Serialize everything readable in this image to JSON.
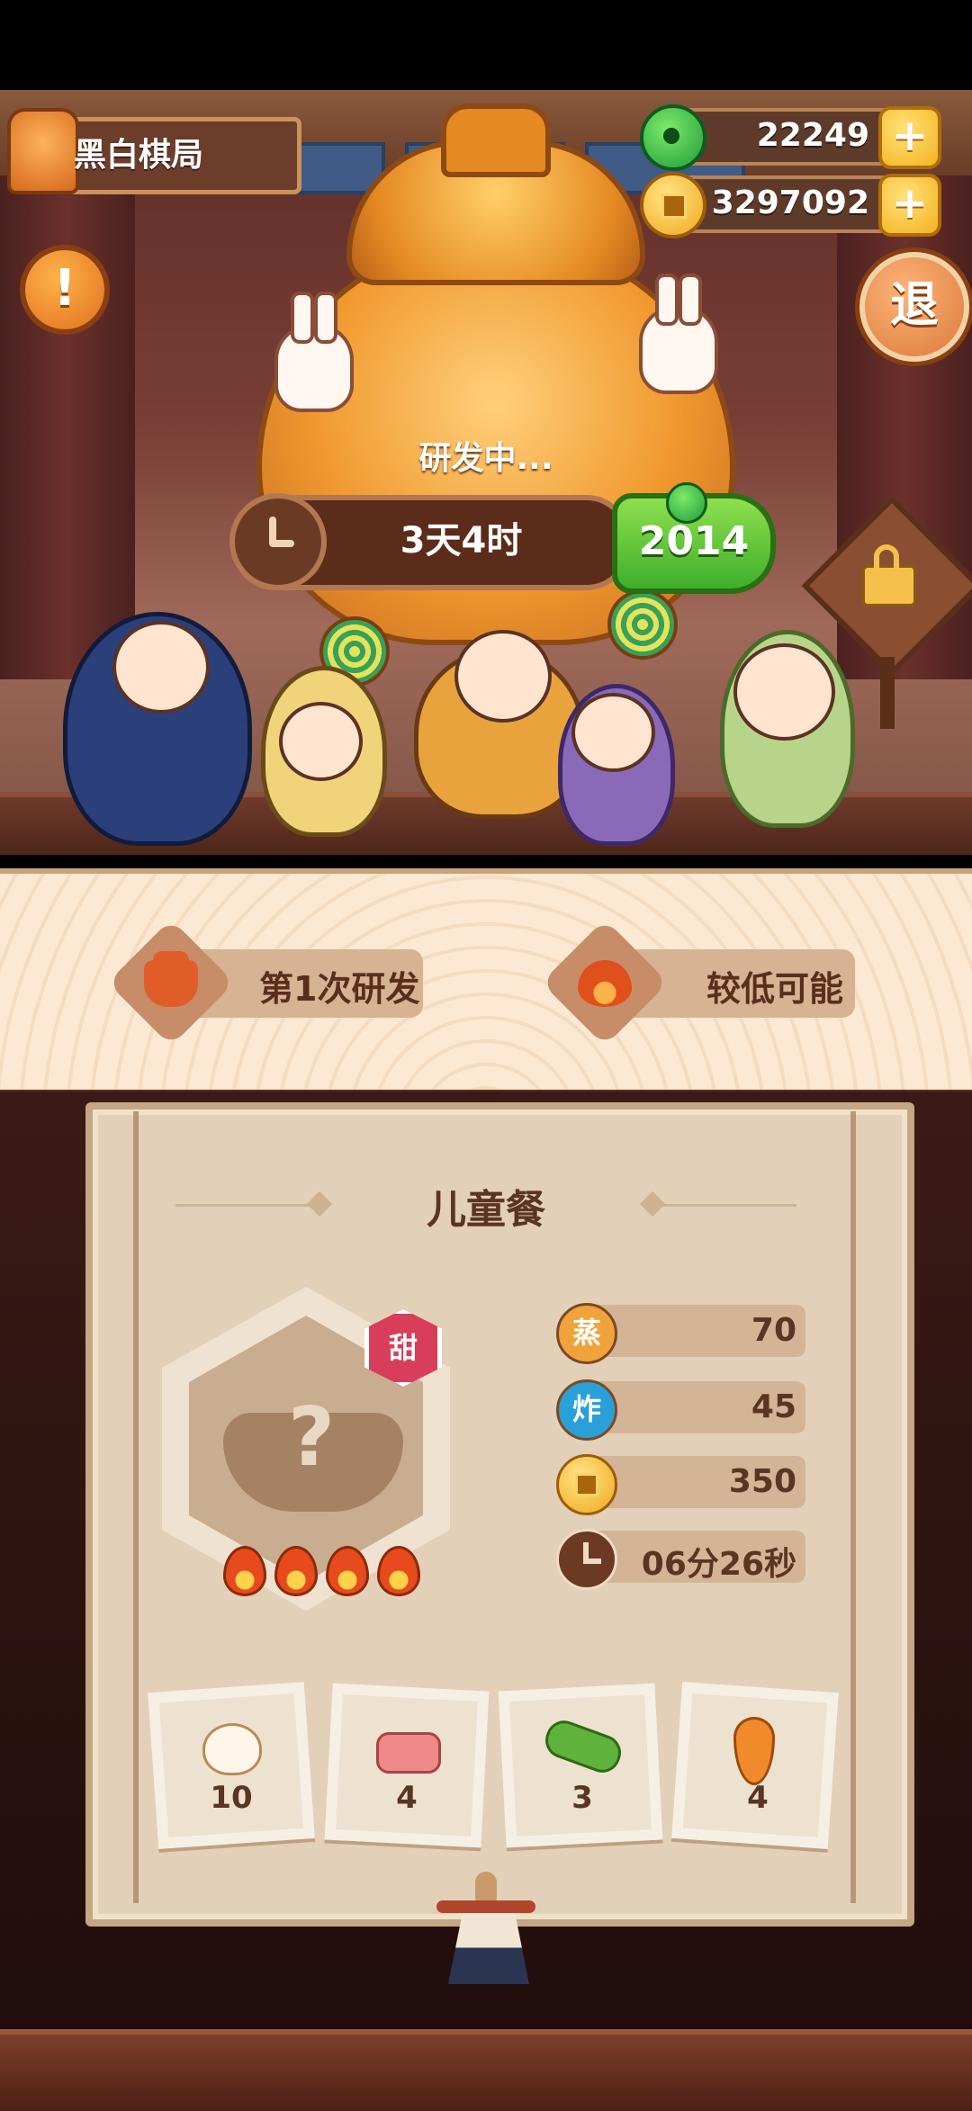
{
  "header": {
    "location_name": "黑白棋局",
    "jade_amount": "22249",
    "gold_amount": "3297092",
    "exit_label": "退",
    "alert_label": "!"
  },
  "research": {
    "status_text": "研发中...",
    "time_remaining": "3天4时",
    "speedup_cost": "2014"
  },
  "banner": {
    "attempt_label": "第1次研发",
    "chance_label": "较低可能"
  },
  "dish": {
    "name": "儿童餐",
    "flavor_badge": "甜",
    "flame_count": 4,
    "unknown_mark": "?",
    "stats": [
      {
        "icon_label": "蒸",
        "icon": "steam-icon",
        "value": "70",
        "color": "#f0a33a"
      },
      {
        "icon_label": "炸",
        "icon": "fry-icon",
        "value": "45",
        "color": "#2aa0d8"
      },
      {
        "icon_label": "",
        "icon": "gold-coin-icon",
        "value": "350",
        "color": "#f1a81b"
      },
      {
        "icon_label": "",
        "icon": "clock-icon",
        "value": "06分26秒",
        "color": "#6c3a24"
      }
    ]
  },
  "ingredients": [
    {
      "name": "egg-icon",
      "count": "10"
    },
    {
      "name": "pork-icon",
      "count": "4"
    },
    {
      "name": "cucumber-icon",
      "count": "3"
    },
    {
      "name": "carrot-icon",
      "count": "4"
    }
  ]
}
